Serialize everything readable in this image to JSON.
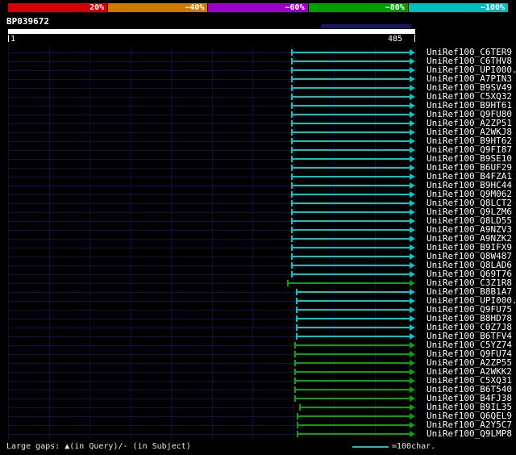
{
  "chart_data": {
    "type": "bar",
    "orientation": "horizontal",
    "title": "BP039672",
    "query": {
      "name": "BP039672",
      "start": 1,
      "end": 485
    },
    "identity_scale": [
      {
        "label": "20%",
        "color": "#d40000"
      },
      {
        "label": "~40%",
        "color": "#cc7a00"
      },
      {
        "label": "~60%",
        "color": "#9a00c8"
      },
      {
        "label": "~80%",
        "color": "#009e00"
      },
      {
        "label": "~100%",
        "color": "#00bcbc"
      }
    ],
    "legend": "=100char.",
    "bars": [
      {
        "label": "UniRef100_C6TER9",
        "start": 338,
        "end": 485,
        "color": "cyan",
        "identity": "~100%"
      },
      {
        "label": "UniRef100_C6THV8",
        "start": 338,
        "end": 485,
        "color": "cyan",
        "identity": "~100%"
      },
      {
        "label": "UniRef100_UPI000..",
        "start": 338,
        "end": 485,
        "color": "cyan",
        "identity": "~100%"
      },
      {
        "label": "UniRef100_A7PIN3",
        "start": 338,
        "end": 485,
        "color": "cyan",
        "identity": "~100%"
      },
      {
        "label": "UniRef100_B9SV49",
        "start": 338,
        "end": 485,
        "color": "cyan",
        "identity": "~100%"
      },
      {
        "label": "UniRef100_C5XQ32",
        "start": 338,
        "end": 485,
        "color": "cyan",
        "identity": "~100%"
      },
      {
        "label": "UniRef100_B9HT61",
        "start": 338,
        "end": 485,
        "color": "cyan",
        "identity": "~100%"
      },
      {
        "label": "UniRef100_Q9FU80",
        "start": 338,
        "end": 485,
        "color": "cyan",
        "identity": "~100%"
      },
      {
        "label": "UniRef100_A2ZP51",
        "start": 338,
        "end": 485,
        "color": "cyan",
        "identity": "~100%"
      },
      {
        "label": "UniRef100_A2WKJ8",
        "start": 338,
        "end": 485,
        "color": "cyan",
        "identity": "~100%"
      },
      {
        "label": "UniRef100_B9HT62",
        "start": 338,
        "end": 485,
        "color": "cyan",
        "identity": "~100%"
      },
      {
        "label": "UniRef100_Q9FI87",
        "start": 338,
        "end": 485,
        "color": "cyan",
        "identity": "~100%"
      },
      {
        "label": "UniRef100_B9SE10",
        "start": 338,
        "end": 485,
        "color": "cyan",
        "identity": "~100%"
      },
      {
        "label": "UniRef100_B6UF29",
        "start": 338,
        "end": 485,
        "color": "cyan",
        "identity": "~100%"
      },
      {
        "label": "UniRef100_B4FZA1",
        "start": 338,
        "end": 485,
        "color": "cyan",
        "identity": "~100%"
      },
      {
        "label": "UniRef100_B9HC44",
        "start": 338,
        "end": 485,
        "color": "cyan",
        "identity": "~100%"
      },
      {
        "label": "UniRef100_Q9M062",
        "start": 338,
        "end": 485,
        "color": "cyan",
        "identity": "~100%"
      },
      {
        "label": "UniRef100_Q8LCT2",
        "start": 338,
        "end": 485,
        "color": "cyan",
        "identity": "~100%"
      },
      {
        "label": "UniRef100_Q9LZM6",
        "start": 338,
        "end": 485,
        "color": "cyan",
        "identity": "~100%"
      },
      {
        "label": "UniRef100_Q8LD55",
        "start": 338,
        "end": 485,
        "color": "cyan",
        "identity": "~100%"
      },
      {
        "label": "UniRef100_A9NZV3",
        "start": 338,
        "end": 485,
        "color": "cyan",
        "identity": "~100%"
      },
      {
        "label": "UniRef100_A9NZK2",
        "start": 338,
        "end": 485,
        "color": "cyan",
        "identity": "~100%"
      },
      {
        "label": "UniRef100_B9IFX9",
        "start": 338,
        "end": 485,
        "color": "cyan",
        "identity": "~100%"
      },
      {
        "label": "UniRef100_Q8W487",
        "start": 338,
        "end": 485,
        "color": "cyan",
        "identity": "~100%"
      },
      {
        "label": "UniRef100_Q8LAD6",
        "start": 338,
        "end": 485,
        "color": "cyan",
        "identity": "~100%"
      },
      {
        "label": "UniRef100_Q69T76",
        "start": 338,
        "end": 485,
        "color": "cyan",
        "identity": "~100%"
      },
      {
        "label": "UniRef100_C3Z1R8",
        "start": 333,
        "end": 485,
        "color": "green",
        "identity": "~80%"
      },
      {
        "label": "UniRef100_B8B1A7",
        "start": 344,
        "end": 485,
        "color": "cyan",
        "identity": "~100%"
      },
      {
        "label": "UniRef100_UPI000..",
        "start": 344,
        "end": 485,
        "color": "cyan",
        "identity": "~100%"
      },
      {
        "label": "UniRef100_Q9FU75",
        "start": 344,
        "end": 485,
        "color": "cyan",
        "identity": "~100%"
      },
      {
        "label": "UniRef100_B8HD78",
        "start": 344,
        "end": 485,
        "color": "cyan",
        "identity": "~100%"
      },
      {
        "label": "UniRef100_C0Z7J8",
        "start": 344,
        "end": 485,
        "color": "cyan",
        "identity": "~100%"
      },
      {
        "label": "UniRef100_B6TFV4",
        "start": 344,
        "end": 485,
        "color": "cyan",
        "identity": "~100%"
      },
      {
        "label": "UniRef100_C5YZ74",
        "start": 342,
        "end": 485,
        "color": "green",
        "identity": "~80%"
      },
      {
        "label": "UniRef100_Q9FU74",
        "start": 342,
        "end": 485,
        "color": "green",
        "identity": "~80%"
      },
      {
        "label": "UniRef100_A2ZP55",
        "start": 342,
        "end": 485,
        "color": "green",
        "identity": "~80%"
      },
      {
        "label": "UniRef100_A2WKK2",
        "start": 342,
        "end": 485,
        "color": "green",
        "identity": "~80%"
      },
      {
        "label": "UniRef100_C5XQ31",
        "start": 342,
        "end": 485,
        "color": "green",
        "identity": "~80%"
      },
      {
        "label": "UniRef100_B6T540",
        "start": 342,
        "end": 485,
        "color": "green",
        "identity": "~80%"
      },
      {
        "label": "UniRef100_B4FJ38",
        "start": 342,
        "end": 485,
        "color": "green",
        "identity": "~80%"
      },
      {
        "label": "UniRef100_B9IL35",
        "start": 348,
        "end": 485,
        "color": "green",
        "identity": "~80%"
      },
      {
        "label": "UniRef100_Q6QEL9",
        "start": 345,
        "end": 485,
        "color": "green",
        "identity": "~80%"
      },
      {
        "label": "UniRef100_A2Y5C7",
        "start": 345,
        "end": 485,
        "color": "green",
        "identity": "~80%"
      },
      {
        "label": "UniRef100_Q9LMP8",
        "start": 345,
        "end": 485,
        "color": "green",
        "identity": "~80%"
      }
    ]
  },
  "footer": {
    "gaps_note": "Large gaps: ▲(in Query)/- (in Subject)"
  },
  "colors": {
    "cyan": "#00c8c8",
    "green": "#00a800",
    "highlight": "#15156e",
    "grid": "#0d0d3c",
    "rowline": "#10104a"
  }
}
